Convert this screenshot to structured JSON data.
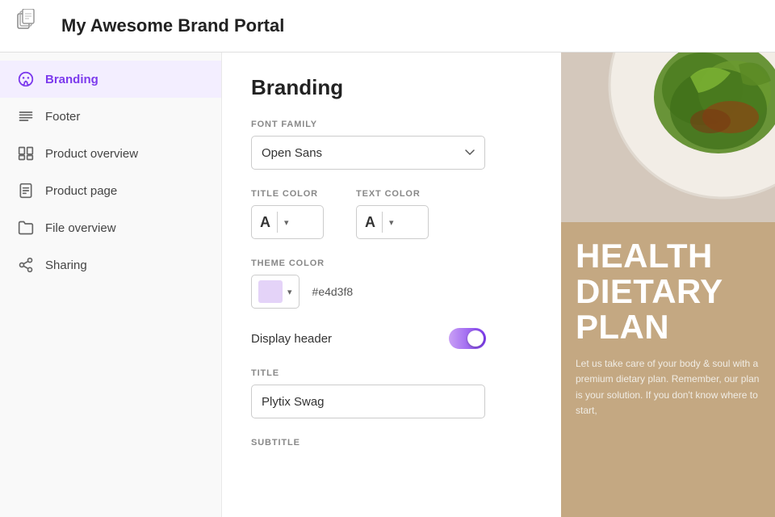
{
  "header": {
    "title": "My Awesome Brand Portal"
  },
  "sidebar": {
    "items": [
      {
        "id": "branding",
        "label": "Branding",
        "active": true
      },
      {
        "id": "footer",
        "label": "Footer",
        "active": false
      },
      {
        "id": "product-overview",
        "label": "Product overview",
        "active": false
      },
      {
        "id": "product-page",
        "label": "Product page",
        "active": false
      },
      {
        "id": "file-overview",
        "label": "File overview",
        "active": false
      },
      {
        "id": "sharing",
        "label": "Sharing",
        "active": false
      }
    ]
  },
  "main": {
    "page_title": "Branding",
    "font_family_label": "FONT FAMILY",
    "font_family_value": "Open Sans",
    "title_color_label": "TITLE COLOR",
    "text_color_label": "TEXT COLOR",
    "theme_color_label": "THEME COLOR",
    "theme_color_hex": "#e4d3f8",
    "theme_color_display": "#e4d3f8",
    "display_header_label": "Display header",
    "title_label": "TITLE",
    "title_value": "Plytix Swag",
    "subtitle_label": "SUBTITLE"
  },
  "preview": {
    "headline_line1": "HEALTH",
    "headline_line2": "DIETARY",
    "headline_line3": "PLAN",
    "body_text": "Let us take care of your body & soul with a premium dietary plan. Remember, our plan is your solution. If you don't know where to start,"
  },
  "colors": {
    "purple_accent": "#7c3aed",
    "sidebar_active_bg": "#f3eeff",
    "theme_swatch": "#e4d3f8"
  }
}
